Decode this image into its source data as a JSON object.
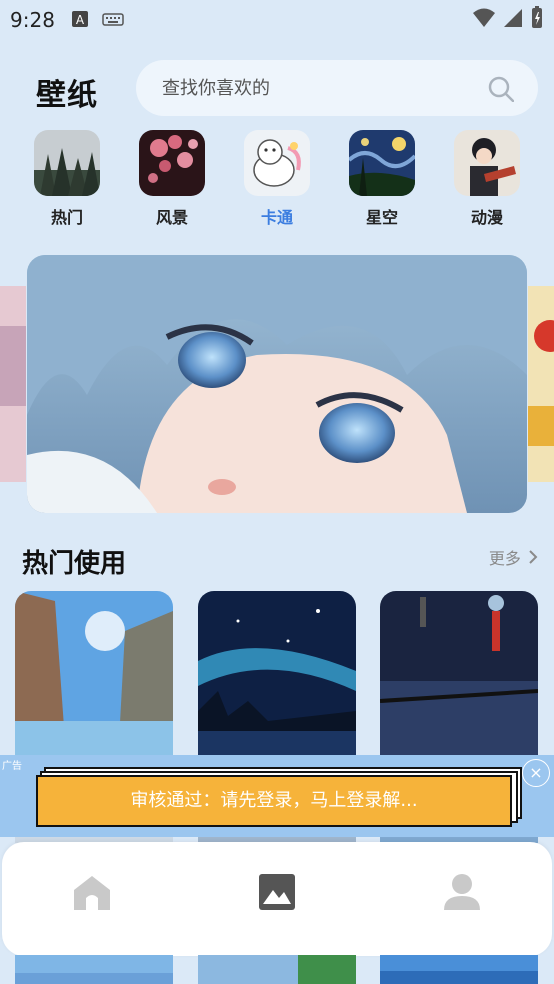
{
  "status": {
    "time": "9:28"
  },
  "header": {
    "title": "壁纸"
  },
  "search": {
    "placeholder": "查找你喜欢的"
  },
  "categories": [
    {
      "label": "热门",
      "active": false
    },
    {
      "label": "风景",
      "active": false
    },
    {
      "label": "卡通",
      "active": true
    },
    {
      "label": "星空",
      "active": false
    },
    {
      "label": "动漫",
      "active": false
    }
  ],
  "section": {
    "title": "热门使用",
    "more": "更多"
  },
  "ad": {
    "tag": "广告",
    "text": "审核通过：请先登录，马上登录解...",
    "close": "×"
  },
  "colors": {
    "accent": "#3b7de0",
    "ad_bg": "#9bc6ef",
    "ad_button": "#f6b33a"
  },
  "nav": [
    "home-icon",
    "image-icon",
    "person-icon"
  ]
}
